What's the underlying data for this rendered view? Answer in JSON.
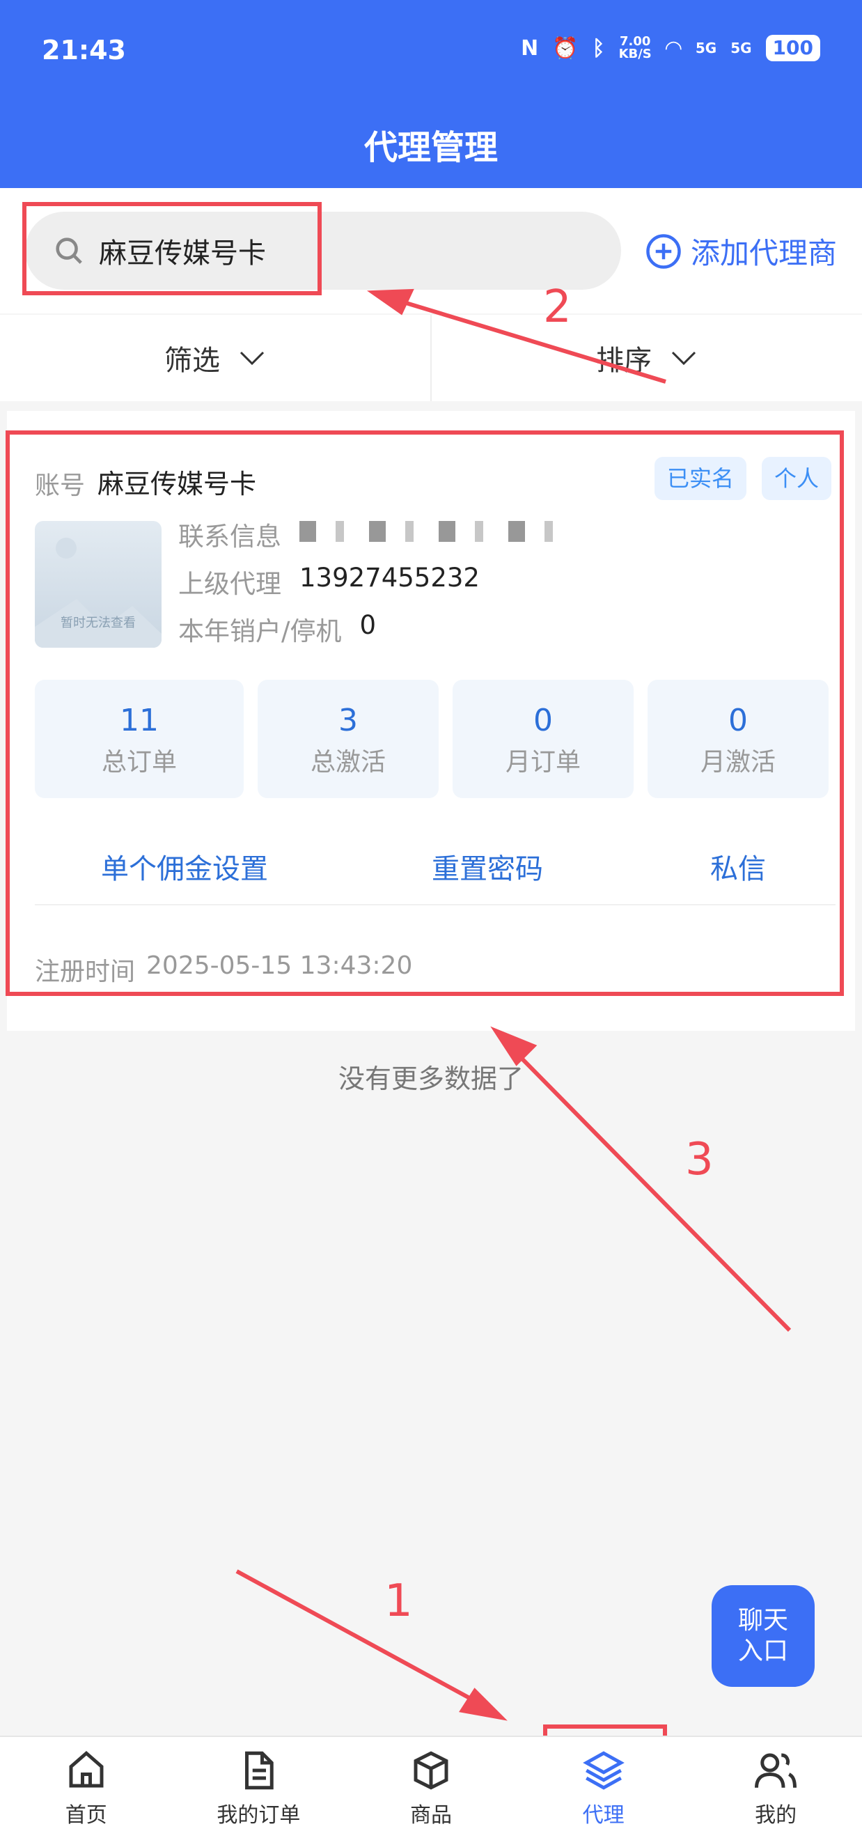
{
  "status_bar": {
    "time": "21:43",
    "network_speed": "7.00\nKB/S",
    "signal_1": "5G",
    "signal_2": "5G",
    "battery": "100"
  },
  "header": {
    "title": "代理管理"
  },
  "search": {
    "value": "麻豆传媒号卡",
    "icon": "search-icon"
  },
  "add_agent": {
    "label": "添加代理商",
    "icon": "plus-circle-icon"
  },
  "filters": {
    "filter_label": "筛选",
    "sort_label": "排序"
  },
  "agent_card": {
    "account_label": "账号",
    "account_value": "麻豆传媒号卡",
    "tags": [
      "已实名",
      "个人"
    ],
    "avatar_caption": "暂时无法查看",
    "contact_label": "联系信息",
    "parent_label": "上级代理",
    "parent_value": "13927455232",
    "cancel_label": "本年销户/停机",
    "cancel_value": "0",
    "stats": [
      {
        "value": "11",
        "label": "总订单"
      },
      {
        "value": "3",
        "label": "总激活"
      },
      {
        "value": "0",
        "label": "月订单"
      },
      {
        "value": "0",
        "label": "月激活"
      }
    ],
    "actions": [
      "单个佣金设置",
      "重置密码",
      "私信"
    ],
    "register_label": "注册时间",
    "register_value": "2025-05-15 13:43:20"
  },
  "list_end_text": "没有更多数据了",
  "chat_button": {
    "line1": "聊天",
    "line2": "入口"
  },
  "annotations": {
    "n1": "1",
    "n2": "2",
    "n3": "3",
    "color": "#ef4a55"
  },
  "tabbar": {
    "items": [
      {
        "label": "首页",
        "icon": "home-icon"
      },
      {
        "label": "我的订单",
        "icon": "order-doc-icon"
      },
      {
        "label": "商品",
        "icon": "package-icon"
      },
      {
        "label": "代理",
        "icon": "layers-icon"
      },
      {
        "label": "我的",
        "icon": "users-icon"
      }
    ],
    "active_index": 3
  },
  "colors": {
    "primary": "#3c6ff5",
    "link": "#2c6fd8",
    "annotation": "#ef4a55"
  }
}
